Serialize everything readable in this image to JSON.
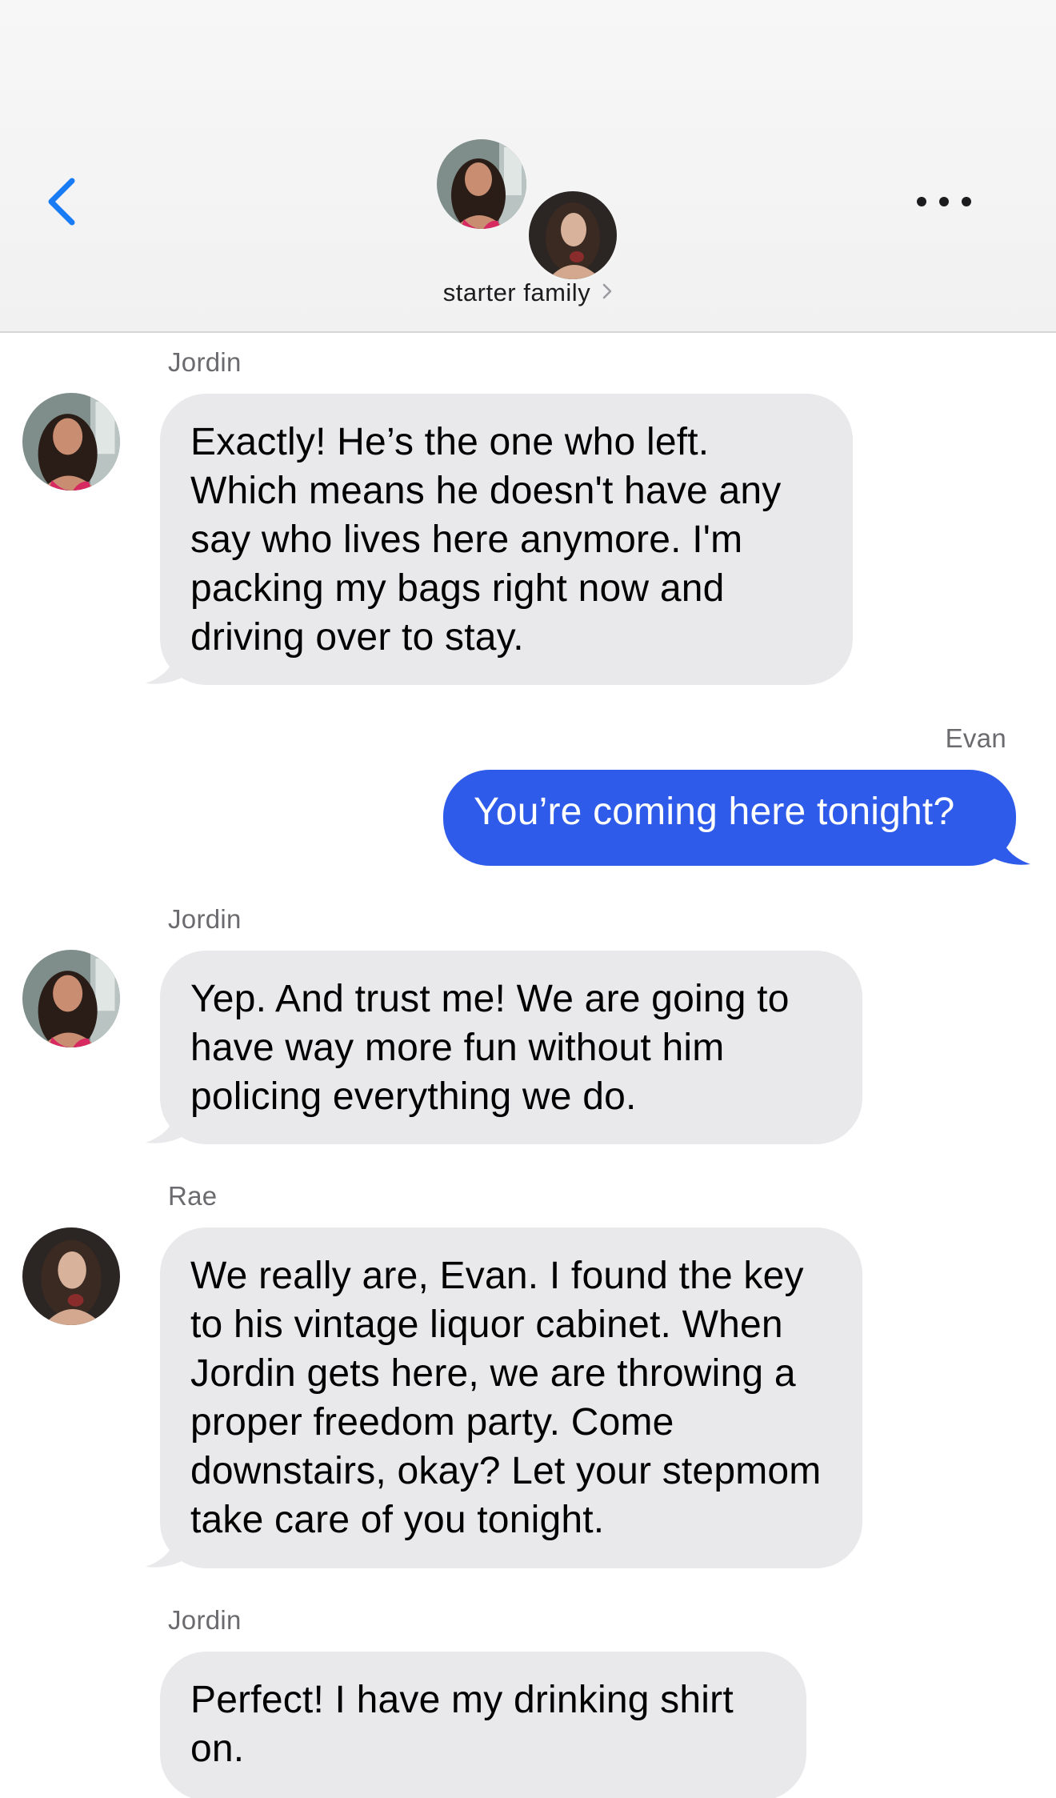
{
  "header": {
    "group_name": "starter family",
    "icons": {
      "back": "chevron-left-icon",
      "more": "ellipsis-icon",
      "group_name_chevron": "chevron-right-icon"
    }
  },
  "colors": {
    "accent": "#1a7cf5",
    "outgoing_bubble": "#2f5bea",
    "incoming_bubble": "#e9e9eb",
    "sender_label": "#6b6b6f"
  },
  "messages": [
    {
      "sender": "Jordin",
      "direction": "incoming",
      "text": "Exactly! He’s the one who left. Which means he doesn't have any say who lives here anymore. I'm packing my bags right now and driving over to stay."
    },
    {
      "sender": "Evan",
      "direction": "outgoing",
      "text": "You’re coming here tonight?"
    },
    {
      "sender": "Jordin",
      "direction": "incoming",
      "text": "Yep. And trust me! We are going to have way more fun without him policing everything we do."
    },
    {
      "sender": "Rae",
      "direction": "incoming",
      "text": "We really are, Evan. I found the key to his vintage liquor cabinet. When Jordin gets here, we are throwing a proper freedom party. Come downstairs, okay? Let your stepmom take care of you tonight."
    },
    {
      "sender": "Jordin",
      "direction": "incoming",
      "text": "Perfect! I have my drinking shirt on."
    }
  ]
}
